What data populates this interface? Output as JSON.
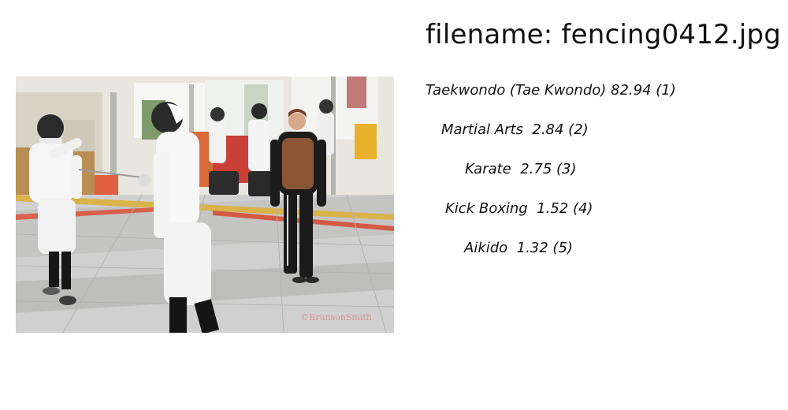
{
  "header": {
    "filename_text": "filename: fencing0412.jpg"
  },
  "photo": {
    "watermark": "©BrunsonSmith"
  },
  "predictions": [
    {
      "text": "Taekwondo (Tae Kwondo) 82.94 (1)"
    },
    {
      "text": "Martial Arts  2.84 (2)"
    },
    {
      "text": "Karate  2.75 (3)"
    },
    {
      "text": "Kick Boxing  1.52 (4)"
    },
    {
      "text": "Aikido  1.32 (5)"
    }
  ]
}
